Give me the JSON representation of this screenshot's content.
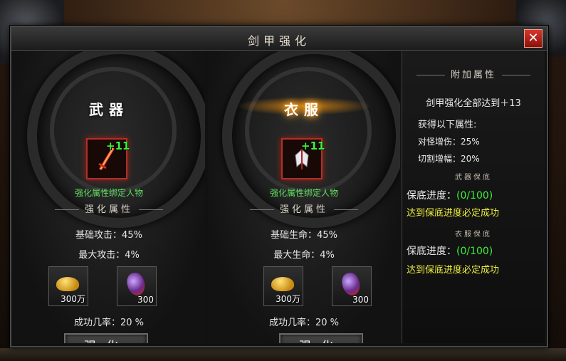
{
  "window": {
    "title": "剑甲强化",
    "close_label": "✕"
  },
  "weapon_panel": {
    "title": "武器",
    "item_level": "+11",
    "bind_note": "强化属性绑定人物",
    "section_title": "强化属性",
    "stats": [
      "基础攻击：45%",
      "最大攻击：4%"
    ],
    "materials": [
      {
        "icon": "gold-ingot-icon",
        "count": "300万"
      },
      {
        "icon": "red-crystal-icon",
        "count": "300"
      }
    ],
    "success_rate": "成功几率：20 %",
    "button_label": "强化"
  },
  "armor_panel": {
    "title": "衣服",
    "item_level": "+11",
    "bind_note": "强化属性绑定人物",
    "section_title": "强化属性",
    "stats": [
      "基础生命：45%",
      "最大生命：4%"
    ],
    "materials": [
      {
        "icon": "gold-ingot-icon",
        "count": "300万"
      },
      {
        "icon": "red-crystal-icon",
        "count": "300"
      }
    ],
    "success_rate": "成功几率：20 %",
    "button_label": "强化"
  },
  "side_panel": {
    "title": "附加属性",
    "all_reach": "剑甲强化全部达到＋13",
    "gain_label": "获得以下属性:",
    "bonuses": [
      "对怪增伤：25%",
      "切割增幅：20%"
    ],
    "weapon_guarantee_title": "武器保底",
    "weapon_progress_label": "保底进度：",
    "weapon_progress_value": "(0/100)",
    "weapon_note": "达到保底进度必定成功",
    "armor_guarantee_title": "衣服保底",
    "armor_progress_label": "保底进度：",
    "armor_progress_value": "(0/100)",
    "armor_note": "达到保底进度必定成功"
  },
  "colors": {
    "accent_green": "#3cf03c",
    "accent_yellow": "#f0f040",
    "close_red": "#d8362a"
  }
}
